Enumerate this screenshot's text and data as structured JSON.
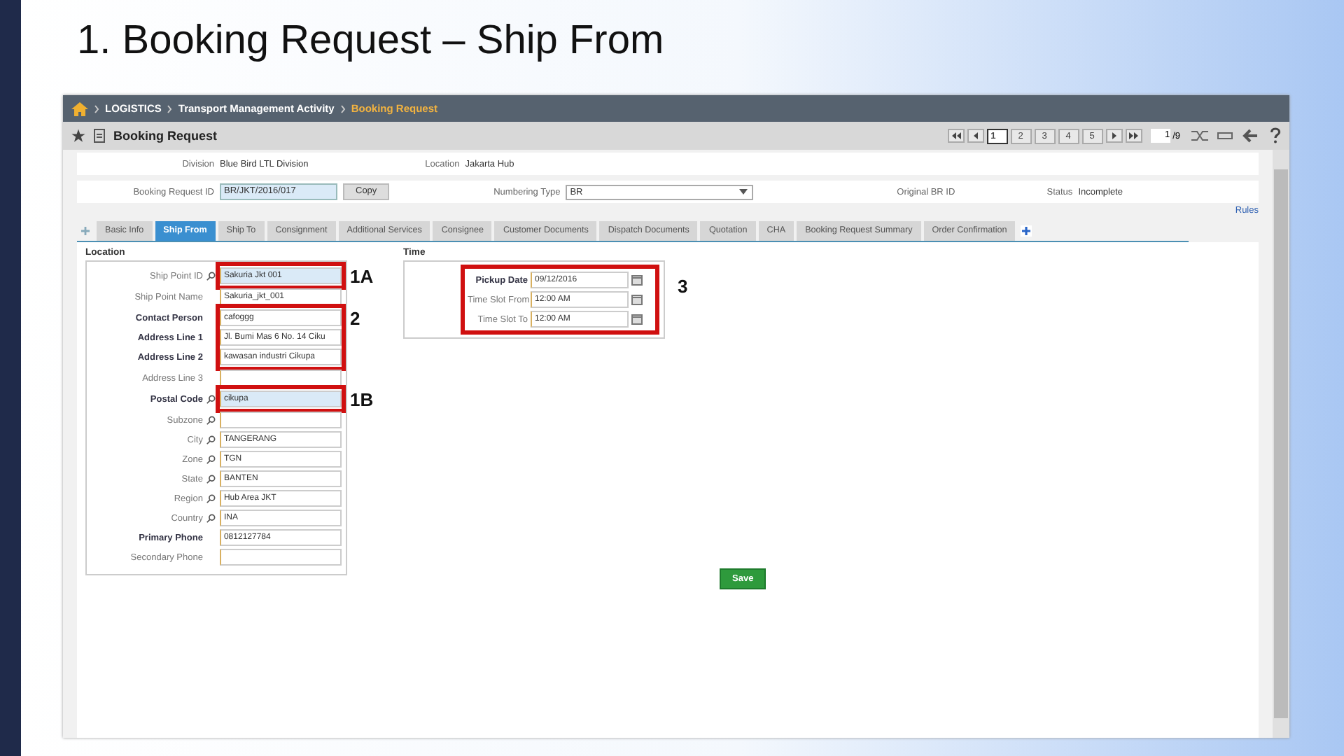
{
  "slide_title": "1. Booking Request – Ship From",
  "breadcrumb": [
    {
      "label": "LOGISTICS",
      "current": false
    },
    {
      "label": "Transport Management Activity",
      "current": false
    },
    {
      "label": "Booking Request",
      "current": true
    }
  ],
  "page_title": "Booking Request",
  "pager": {
    "pages": [
      {
        "label": "1",
        "selected": true
      },
      {
        "label": "2",
        "selected": false
      },
      {
        "label": "3",
        "selected": false
      },
      {
        "label": "4",
        "selected": false
      },
      {
        "label": "5",
        "selected": false
      }
    ],
    "page_input": "1",
    "total": "/9"
  },
  "header_fields": [
    {
      "label": "Division",
      "value": "Blue Bird LTL Division",
      "kind": "text"
    },
    {
      "label": "Location",
      "value": "Jakarta Hub",
      "kind": "text"
    }
  ],
  "id_row": {
    "label": "Booking Request ID",
    "value": "BR/JKT/2016/017",
    "copy": "Copy",
    "numbering_label": "Numbering Type",
    "numbering_value": "BR",
    "original_label": "Original BR ID",
    "status_label": "Status",
    "status_value": "Incomplete"
  },
  "rules_link": "Rules",
  "tabs": [
    {
      "label": "Basic Info",
      "selected": false
    },
    {
      "label": "Ship From",
      "selected": true
    },
    {
      "label": "Ship To",
      "selected": false
    },
    {
      "label": "Consignment",
      "selected": false
    },
    {
      "label": "Additional Services",
      "selected": false
    },
    {
      "label": "Consignee",
      "selected": false
    },
    {
      "label": "Customer Documents",
      "selected": false
    },
    {
      "label": "Dispatch Documents",
      "selected": false
    },
    {
      "label": "Quotation",
      "selected": false
    },
    {
      "label": "CHA",
      "selected": false
    },
    {
      "label": "Booking Request Summary",
      "selected": false
    },
    {
      "label": "Order Confirmation",
      "selected": false
    }
  ],
  "location": {
    "title": "Location",
    "groups": [
      {
        "callout": "1A",
        "fields": [
          {
            "label": "Ship Point ID",
            "value": "Sakuria Jkt 001",
            "lookup": true,
            "required": false,
            "filled": true
          }
        ]
      },
      {
        "fields": [
          {
            "label": "Ship Point Name",
            "value": "Sakuria_jkt_001",
            "lookup": false,
            "required": false,
            "filled": false
          }
        ]
      },
      {
        "callout": "2",
        "fields": [
          {
            "label": "Contact Person",
            "value": "cafoggg",
            "lookup": false,
            "required": true,
            "filled": false
          },
          {
            "label": "Address Line 1",
            "value": "Jl. Bumi Mas 6 No. 14 Ciku",
            "lookup": false,
            "required": true,
            "filled": false
          },
          {
            "label": "Address Line 2",
            "value": "kawasan industri Cikupa",
            "lookup": false,
            "required": true,
            "filled": false
          }
        ]
      },
      {
        "fields": [
          {
            "label": "Address Line 3",
            "lookup": false,
            "required": false,
            "filled": false
          }
        ]
      },
      {
        "callout": "1B",
        "fields": [
          {
            "label": "Postal Code",
            "value": "cikupa",
            "lookup": true,
            "required": true,
            "filled": true
          }
        ]
      },
      {
        "fields": [
          {
            "label": "Subzone",
            "lookup": true,
            "required": false,
            "filled": false
          },
          {
            "label": "City",
            "value": "TANGERANG",
            "lookup": true,
            "required": false,
            "filled": false
          },
          {
            "label": "Zone",
            "value": "TGN",
            "lookup": true,
            "required": false,
            "filled": false
          },
          {
            "label": "State",
            "value": "BANTEN",
            "lookup": true,
            "required": false,
            "filled": false
          },
          {
            "label": "Region",
            "value": "Hub Area JKT",
            "lookup": true,
            "required": false,
            "filled": false
          },
          {
            "label": "Country",
            "value": "INA",
            "lookup": true,
            "required": false,
            "filled": false
          },
          {
            "label": "Primary Phone",
            "value": "0812127784",
            "lookup": false,
            "required": true,
            "filled": false
          },
          {
            "label": "Secondary Phone",
            "lookup": false,
            "required": false,
            "filled": false
          }
        ]
      }
    ]
  },
  "time": {
    "title": "Time",
    "callout": "3",
    "fields": [
      {
        "label": "Pickup Date",
        "value": "09/12/2016",
        "required": true
      },
      {
        "label": "Time Slot From",
        "value": "12:00 AM",
        "required": false
      },
      {
        "label": "Time Slot To",
        "value": "12:00 AM",
        "required": false
      }
    ]
  },
  "save_button": "Save"
}
